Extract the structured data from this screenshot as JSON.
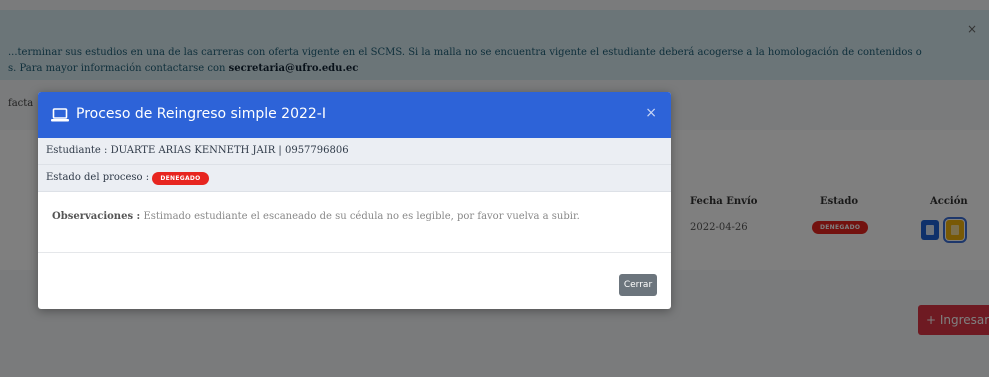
{
  "background": {
    "alert_line1": "...terminar sus estudios en una de las carreras con oferta vigente en el SCMS. Si la malla no se encuentra vigente el estudiante deberá acogerse a la homologación de contenidos o",
    "alert_line2": "s. Para mayor información contactarse con",
    "alert_email": "secretaria@ufro.edu.ec",
    "alert_close": "×",
    "partial_label": "facta",
    "table_headers": {
      "fecha": "Fecha Envío",
      "estado": "Estado",
      "accion": "Acción"
    },
    "row": {
      "fecha": "2022-04-26",
      "estado": "DENEGADO"
    },
    "ingresar_button": "+ Ingresar"
  },
  "modal": {
    "title": "Proceso de Reingreso simple 2022-I",
    "close_x": "×",
    "student_label": "Estudiante :",
    "student_value": "DUARTE ARIAS KENNETH JAIR | 0957796806",
    "estado_label": "Estado del proceso :",
    "estado_badge": "DENEGADO",
    "obs_label": "Observaciones :",
    "obs_text": "Estimado estudiante el escaneado de su cédula no es legible, por favor vuelva a subir.",
    "close_button": "Cerrar"
  },
  "colors": {
    "modal_header": "#2d63d8",
    "badge": "#e7251f",
    "close_button": "#6c757d",
    "alert_bg": "#d6eaf0",
    "ingresar": "#dc3545"
  }
}
